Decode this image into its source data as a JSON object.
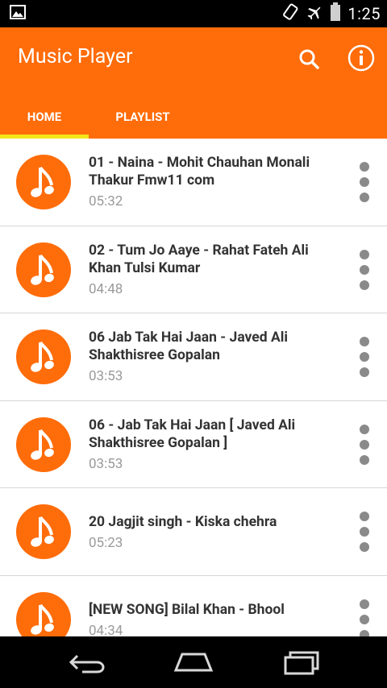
{
  "status_bar": {
    "time": "1:25",
    "icons": [
      "image-notification-icon",
      "rotation-icon",
      "airplane-mode-icon",
      "battery-icon"
    ]
  },
  "app_bar": {
    "title": "Music Player",
    "actions": [
      "search-icon",
      "info-icon"
    ]
  },
  "tabs": [
    {
      "label": "HOME",
      "selected": true
    },
    {
      "label": "PLAYLIST",
      "selected": false
    }
  ],
  "colors": {
    "accent": "#ff6c0a",
    "tab_indicator": "#f5e61c"
  },
  "songs": [
    {
      "title": "01 - Naina - Mohit Chauhan   Monali Thakur   Fmw11 com",
      "duration": "05:32"
    },
    {
      "title": "02 - Tum Jo Aaye - Rahat Fateh Ali Khan  Tulsi Kumar",
      "duration": "04:48"
    },
    {
      "title": "06  Jab Tak Hai Jaan - Javed Ali Shakthisree Gopalan",
      "duration": "03:53"
    },
    {
      "title": "06 - Jab Tak Hai Jaan [ Javed Ali Shakthisree Gopalan ]",
      "duration": "03:53"
    },
    {
      "title": "20 Jagjit singh - Kiska chehra",
      "duration": "05:23"
    },
    {
      "title": "[NEW SONG] Bilal Khan - Bhool",
      "duration": "04:34"
    }
  ],
  "nav_bar": {
    "buttons": [
      "back-icon",
      "home-icon",
      "recents-icon"
    ]
  }
}
